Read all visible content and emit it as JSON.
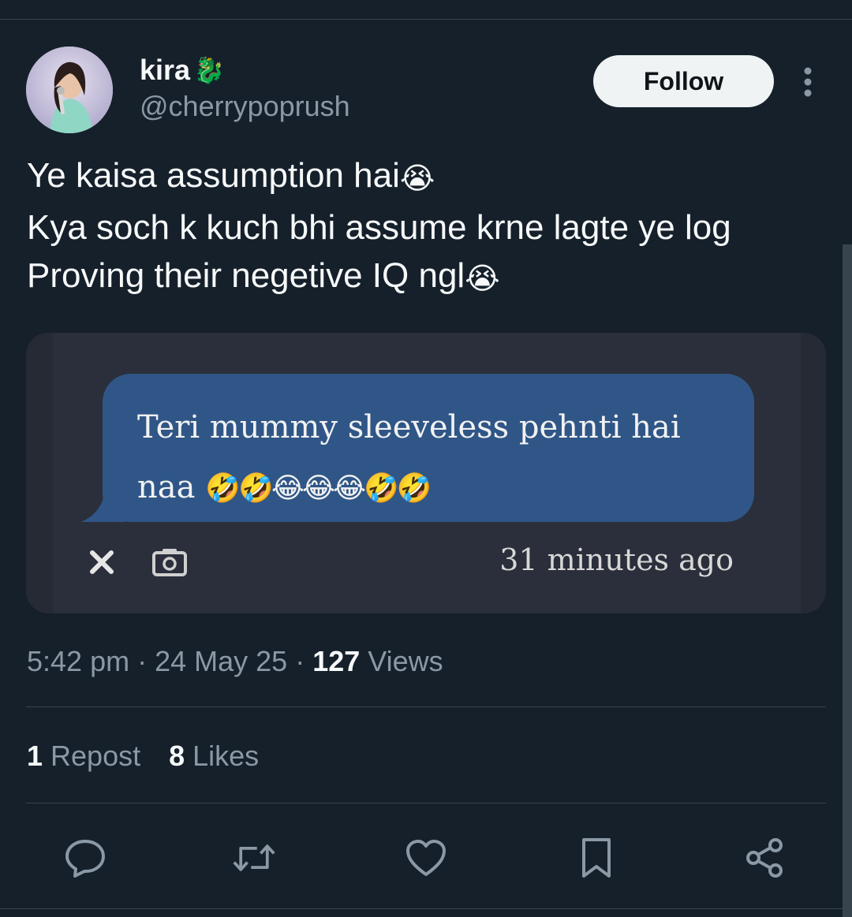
{
  "author": {
    "display_name": "kira",
    "name_emoji": "🐉",
    "handle": "@cherrypoprush"
  },
  "header": {
    "follow_label": "Follow"
  },
  "tweet": {
    "lines": [
      {
        "text": "Ye kaisa assumption hai",
        "emoji": "😭"
      },
      {
        "text": "Kya soch k kuch bhi assume krne lagte ye log",
        "emoji": ""
      },
      {
        "text": "Proving their negetive IQ ngl",
        "emoji": "😭"
      }
    ]
  },
  "media": {
    "message_text": "Teri mummy sleeveless pehnti hai naa",
    "message_emojis": "🤣🤣😂😂😂🤣🤣",
    "time_ago": "31 minutes ago",
    "close_icon": "close-icon",
    "camera_icon": "camera-icon"
  },
  "meta": {
    "time": "5:42 pm",
    "sep1": " · ",
    "date": "24 May 25",
    "sep2": " · ",
    "views_count": "127",
    "views_label": " Views"
  },
  "stats": {
    "reposts_count": "1",
    "reposts_label": " Repost",
    "likes_count": "8",
    "likes_label": " Likes"
  },
  "actions": [
    "reply-icon",
    "repost-icon",
    "like-icon",
    "bookmark-icon",
    "share-icon"
  ],
  "colors": {
    "background": "#15202b",
    "bubble": "#2f5687",
    "muted_text": "#8b98a5",
    "divider": "#38444d"
  }
}
